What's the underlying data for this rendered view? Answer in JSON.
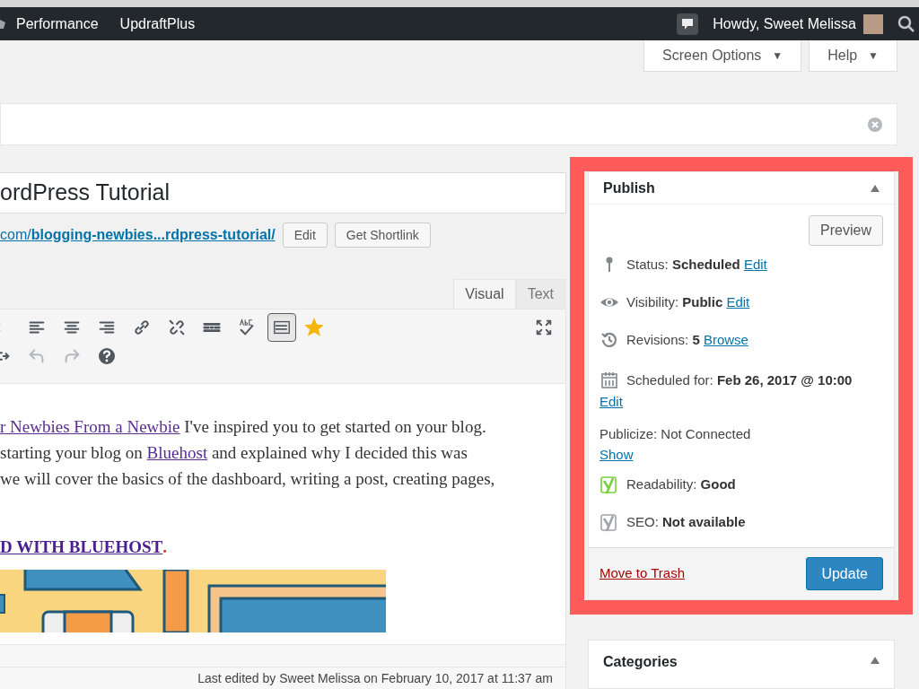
{
  "admin_bar": {
    "menu_items": [
      "Performance",
      "UpdraftPlus"
    ],
    "greeting": "Howdy, Sweet Melissa"
  },
  "screen_meta": {
    "buttons": [
      "Screen Options",
      "Help"
    ],
    "caret": "▼"
  },
  "editor": {
    "title": "ordPress Tutorial",
    "permalink": {
      "prefix": "com/",
      "slug": "blogging-newbies...rdpress-tutorial/"
    },
    "permalink_buttons": [
      "Edit",
      "Get Shortlink"
    ],
    "tabs": [
      {
        "label": "Visual",
        "selected": true
      },
      {
        "label": "Text",
        "selected": false
      }
    ],
    "toolbar": {
      "toolbar_toggle_pressed": true,
      "undo_disabled": true,
      "redo_disabled": true
    },
    "content_lines": [
      [
        {
          "kind": "link",
          "text": "r Newbies From a Newbie"
        },
        {
          "kind": "text",
          "text": " I've inspired you to get started on your blog."
        }
      ],
      [
        {
          "kind": "text",
          "text": " starting your blog on "
        },
        {
          "kind": "link",
          "text": "Bluehost"
        },
        {
          "kind": "text",
          "text": " and explained why I decided this was"
        }
      ],
      [
        {
          "kind": "text",
          "text": "we will cover the basics of the dashboard, writing a post, creating pages,"
        }
      ]
    ],
    "heading_link": "D WITH BLUEHOST",
    "heading_period": ".",
    "status_bar": "Last edited by Sweet Melissa on February 10, 2017 at 11:37 am"
  },
  "publish": {
    "title": "Publish",
    "preview": "Preview",
    "rows": [
      {
        "kind": "status",
        "label": "Status:",
        "value": "Scheduled",
        "link": "Edit"
      },
      {
        "kind": "visibility",
        "label": "Visibility:",
        "value": "Public",
        "link": "Edit"
      },
      {
        "kind": "revisions",
        "label": "Revisions:",
        "value": "5",
        "link": "Browse"
      },
      {
        "kind": "schedule",
        "label": "Scheduled for:",
        "value": "Feb 26, 2017 @ 10:00",
        "link": "Edit"
      },
      {
        "kind": "publicize",
        "label": "Publicize: Not Connected",
        "link": "Show"
      },
      {
        "kind": "yoast",
        "label": "Readability:",
        "value": "Good",
        "color": "#7ad03a"
      },
      {
        "kind": "yoast",
        "label": "SEO:",
        "value": "Not available",
        "color": "#a0a5aa"
      }
    ],
    "trash": "Move to Trash",
    "update": "Update"
  },
  "categories": {
    "title": "Categories"
  }
}
